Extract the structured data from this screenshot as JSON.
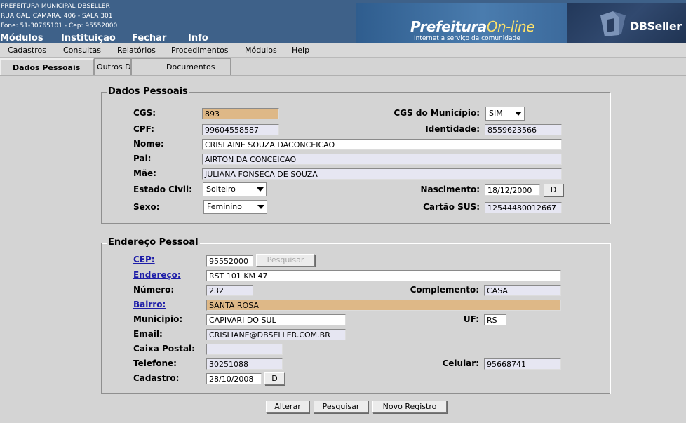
{
  "header": {
    "org_line1": "PREFEITURA MUNICIPAL DBSELLER",
    "org_line2": "RUA GAL. CAMARA, 406 - SALA 301",
    "org_line3": "Fone: 51-30765101  -  Cep: 95552000",
    "menu": [
      "Módulos",
      "Instituição",
      "Fechar",
      "Info"
    ],
    "banner_title_a": "Prefeitura",
    "banner_title_b": "On-line",
    "banner_subtitle": "Internet a serviço da comunidade",
    "logo_text": "DBSeller"
  },
  "menubar": [
    "Cadastros",
    "Consultas",
    "Relatórios",
    "Procedimentos",
    "Módulos",
    "Help"
  ],
  "tabs": [
    "Dados Pessoais",
    "Outros Dados",
    "Documentos"
  ],
  "dados": {
    "legend": "Dados Pessoais",
    "cgs_label": "CGS:",
    "cgs": "893",
    "cgs_mun_label": "CGS do Município:",
    "cgs_mun": "SIM",
    "cpf_label": "CPF:",
    "cpf": "99604558587",
    "identidade_label": "Identidade:",
    "identidade": "8559623566",
    "nome_label": "Nome:",
    "nome": "CRISLAINE SOUZA DACONCEICAO",
    "pai_label": "Pai:",
    "pai": "AIRTON DA CONCEICAO",
    "mae_label": "Mãe:",
    "mae": "JULIANA FONSECA DE SOUZA",
    "estado_civil_label": "Estado Civil:",
    "estado_civil": "Solteiro",
    "nascimento_label": "Nascimento:",
    "nascimento": "18/12/2000",
    "nascimento_btn": "D",
    "sexo_label": "Sexo:",
    "sexo": "Feminino",
    "sus_label": "Cartão SUS:",
    "sus": "12544480012667"
  },
  "endereco": {
    "legend": "Endereço Pessoal",
    "cep_label": "CEP:",
    "cep": "95552000",
    "pesquisar": "Pesquisar",
    "endereco_label": "Endereço:",
    "endereco": "RST 101 KM 47",
    "numero_label": "Número:",
    "numero": "232",
    "complemento_label": "Complemento:",
    "complemento": "CASA",
    "bairro_label": "Bairro:",
    "bairro": "SANTA ROSA",
    "municipio_label": "Municipio:",
    "municipio": "CAPIVARI DO SUL",
    "uf_label": "UF:",
    "uf": "RS",
    "email_label": "Email:",
    "email": "CRISLIANE@DBSELLER.COM.BR",
    "caixa_label": "Caixa Postal:",
    "caixa": "",
    "telefone_label": "Telefone:",
    "telefone": "30251088",
    "celular_label": "Celular:",
    "celular": "95668741",
    "cadastro_label": "Cadastro:",
    "cadastro": "28/10/2008",
    "cadastro_btn": "D"
  },
  "actions": [
    "Alterar",
    "Pesquisar",
    "Novo Registro"
  ]
}
